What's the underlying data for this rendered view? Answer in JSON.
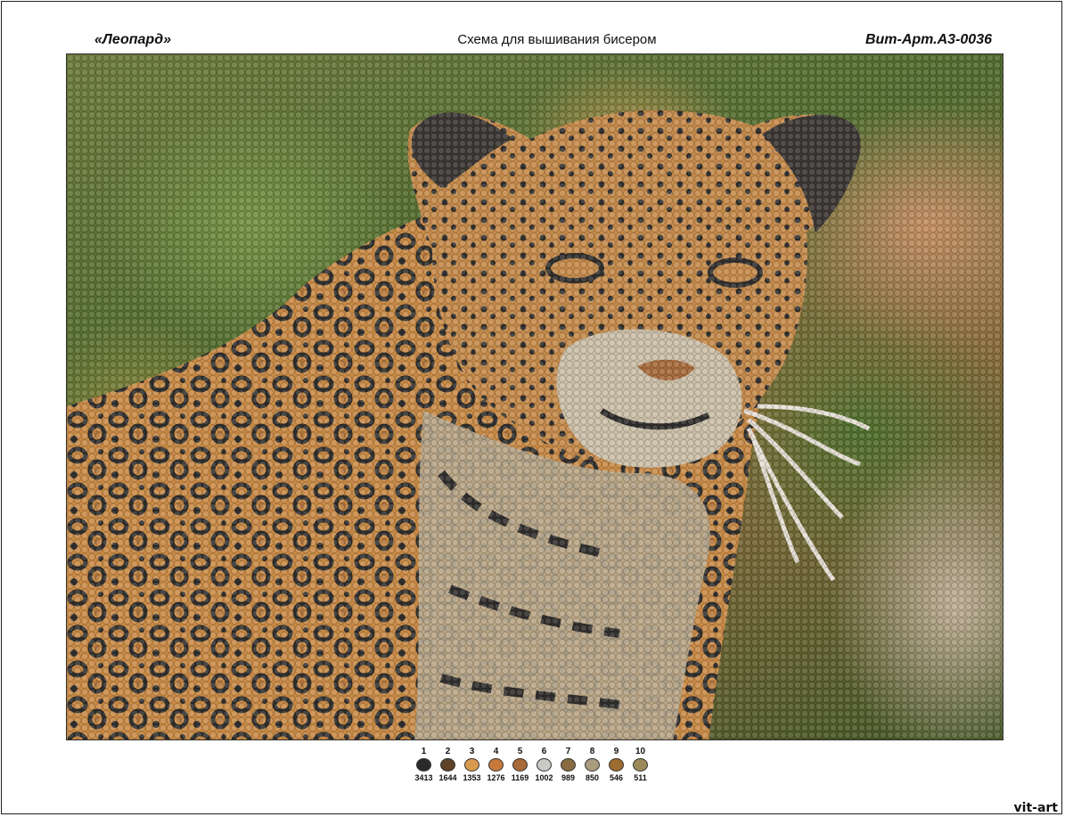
{
  "header": {
    "title": "«Леопард»",
    "subtitle": "Схема для вышивания бисером",
    "code": "Вит-Арт.А3-0036"
  },
  "palette": [
    {
      "num": "1",
      "code": "3413",
      "color": "#2b2a28"
    },
    {
      "num": "2",
      "code": "1644",
      "color": "#5e4126"
    },
    {
      "num": "3",
      "code": "1353",
      "color": "#d89a4e"
    },
    {
      "num": "4",
      "code": "1276",
      "color": "#c8793a"
    },
    {
      "num": "5",
      "code": "1169",
      "color": "#a86a38"
    },
    {
      "num": "6",
      "code": "1002",
      "color": "#c7cbc3"
    },
    {
      "num": "7",
      "code": "989",
      "color": "#8a6a42"
    },
    {
      "num": "8",
      "code": "850",
      "color": "#a89b7e"
    },
    {
      "num": "9",
      "code": "546",
      "color": "#9c6b2e"
    },
    {
      "num": "10",
      "code": "511",
      "color": "#9c8a5a"
    }
  ],
  "watermark": "vit-art"
}
